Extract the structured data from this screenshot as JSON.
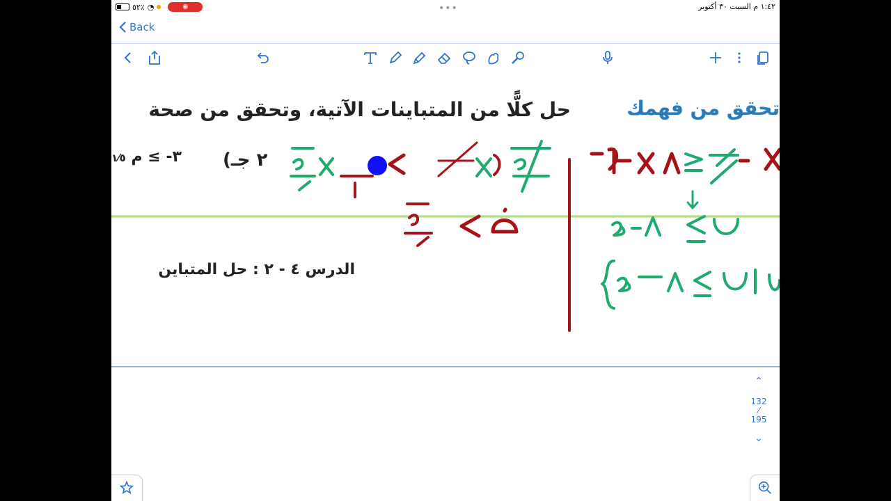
{
  "status": {
    "datetime": "١:٤٢ م   السبت ٣٠ أكتوبر",
    "battery": "٥٢٪"
  },
  "nav": {
    "back_label": "Back"
  },
  "document": {
    "heading_section": "تحقق من فهمك",
    "instruction": "حل كلًّا من المتباينات الآتية، وتحقق من صحة",
    "problem_c": "٢ جـ)",
    "lesson_ref": "الدرس ٤ - ٢ :   حل المتباين"
  },
  "pager": {
    "current": "132",
    "total": "195"
  },
  "colors": {
    "accent": "#2f74d0",
    "ink_red": "#a5121a",
    "ink_green": "#1faa6e",
    "ink_blue": "#1010ff"
  }
}
